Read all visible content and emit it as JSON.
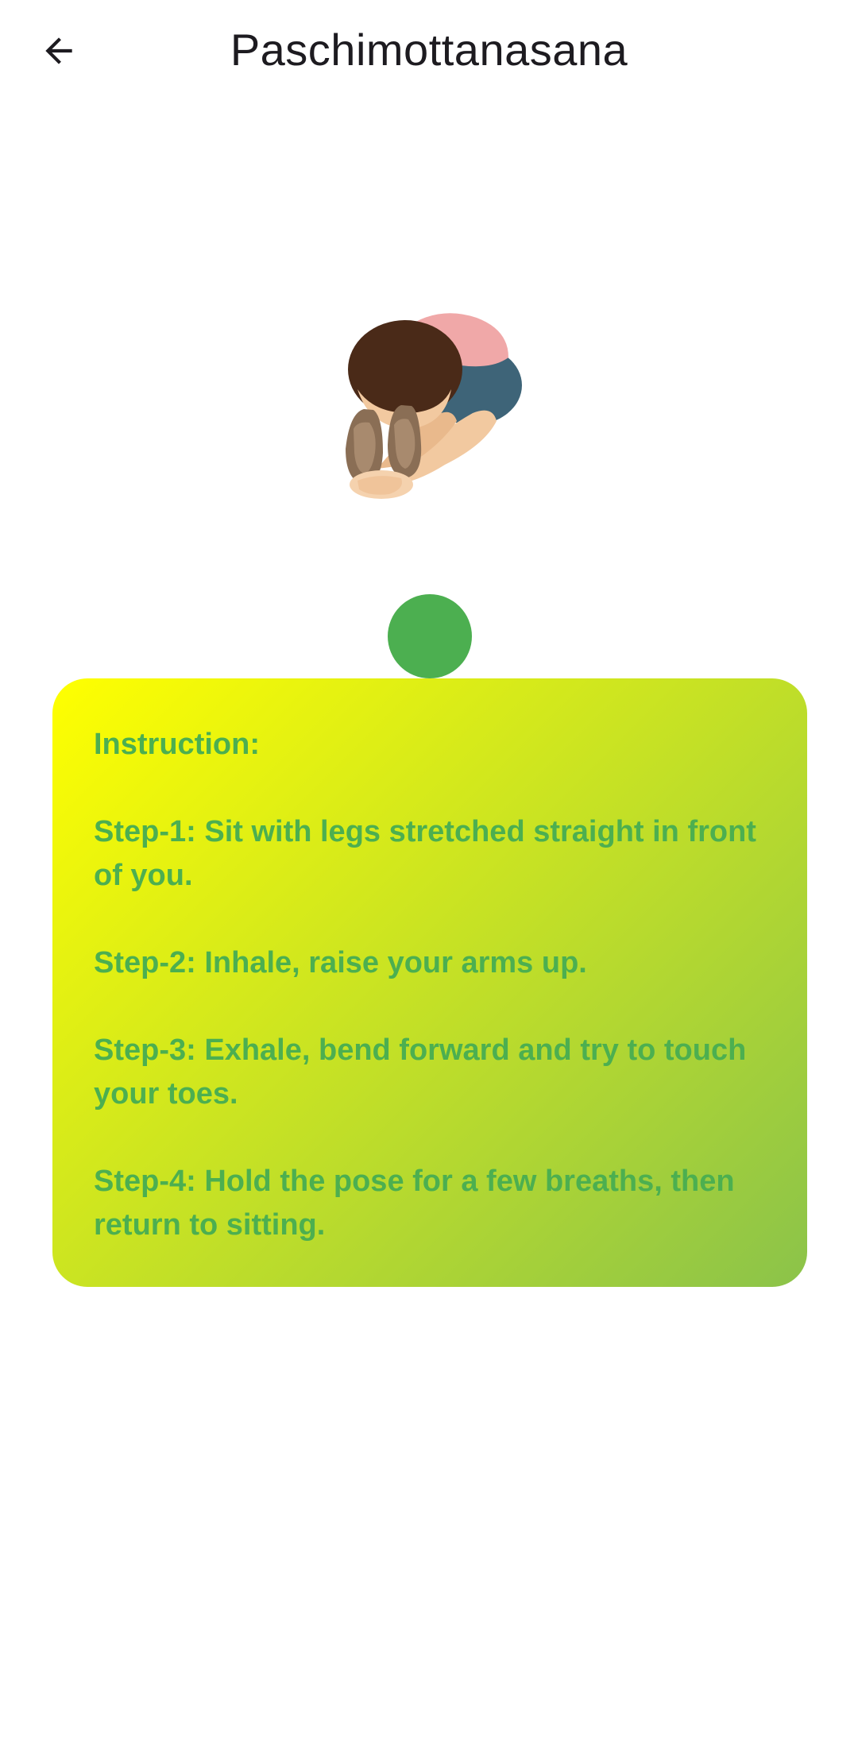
{
  "app_bar": {
    "title": "Paschimottanasana",
    "back_icon": "arrow-back-icon"
  },
  "pose": {
    "image_icon": "seated-forward-bend-figure"
  },
  "colors": {
    "indicator": "#4caf50",
    "card_gradient_start": "#ffff00",
    "card_gradient_end": "#8bc34a",
    "instruction_text": "#4caf50",
    "title_text": "#1d1b20"
  },
  "instructions": {
    "heading": "Instruction:",
    "steps": [
      "Step-1: Sit with legs stretched straight in front of you.",
      "Step-2: Inhale, raise your arms up.",
      "Step-3: Exhale, bend forward and try to touch your toes.",
      "Step-4: Hold the pose for a few breaths, then return to sitting."
    ]
  }
}
